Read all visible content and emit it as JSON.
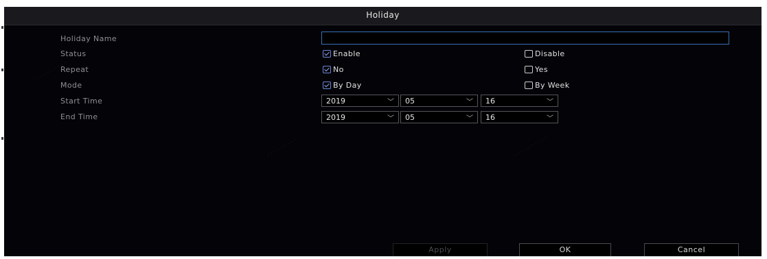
{
  "dialog": {
    "title": "Holiday"
  },
  "form": {
    "holiday_name": {
      "label": "Holiday Name",
      "value": ""
    },
    "status": {
      "label": "Status",
      "options": [
        {
          "label": "Enable",
          "checked": true
        },
        {
          "label": "Disable",
          "checked": false
        }
      ]
    },
    "repeat": {
      "label": "Repeat",
      "options": [
        {
          "label": "No",
          "checked": true
        },
        {
          "label": "Yes",
          "checked": false
        }
      ]
    },
    "mode": {
      "label": "Mode",
      "options": [
        {
          "label": "By Day",
          "checked": true
        },
        {
          "label": "By Week",
          "checked": false
        }
      ]
    },
    "start_time": {
      "label": "Start Time",
      "year": "2019",
      "month": "05",
      "day": "16"
    },
    "end_time": {
      "label": "End Time",
      "year": "2019",
      "month": "05",
      "day": "16"
    }
  },
  "buttons": {
    "apply": "Apply",
    "ok": "OK",
    "cancel": "Cancel"
  },
  "icons": {
    "dropdown": "chevron-down-icon",
    "checkbox": "checkbox-icon"
  },
  "colors": {
    "background": "#040408",
    "titlebar": "#1a1a1e",
    "input_border": "#3a6fb8",
    "checkbox_checked": "#8ea6ee",
    "label": "#8e8e94"
  }
}
